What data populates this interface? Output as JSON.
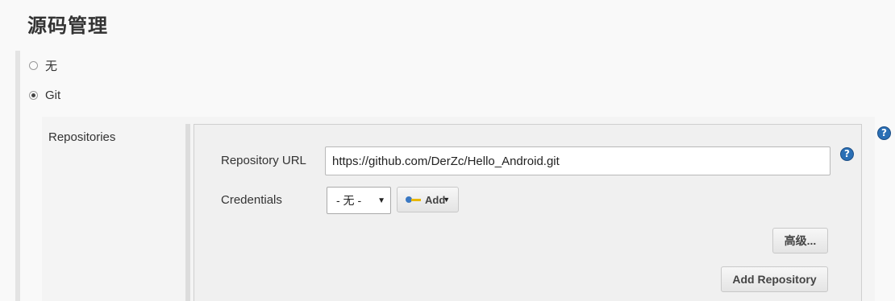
{
  "section": {
    "title": "源码管理"
  },
  "scm_options": [
    {
      "label": "无",
      "checked": false
    },
    {
      "label": "Git",
      "checked": true
    }
  ],
  "git": {
    "repositories_label": "Repositories",
    "repository_url_label": "Repository URL",
    "repository_url_value": "https://github.com/DerZc/Hello_Android.git",
    "credentials_label": "Credentials",
    "credentials_selected": "- 无 -",
    "add_button_label": "Add",
    "advanced_button_label": "高级...",
    "add_repository_button_label": "Add Repository"
  },
  "icons": {
    "help": "help-icon",
    "key": "key-icon",
    "select_arrow": "chevron-down-icon"
  },
  "colors": {
    "help_blue": "#2a6fb5",
    "key_blue": "#3a78c3",
    "key_gold": "#e8b700"
  }
}
